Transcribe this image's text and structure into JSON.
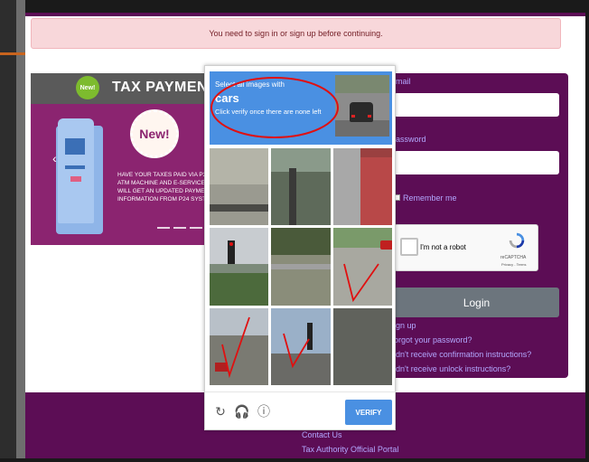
{
  "alert": {
    "message": "You need to sign in or sign up before continuing."
  },
  "banner": {
    "title": "TAX PAYMENT",
    "new_small": "New!",
    "new_big": "New!",
    "arrow": "‹",
    "text_lines": [
      "HAVE YOUR TAXES PAID VIA P2",
      "ATM MACHINE AND E-SERVICE",
      "WILL GET AN UPDATED PAYMEN",
      "INFORMATION FROM P24 SYSTE"
    ]
  },
  "login": {
    "email_label": "mail",
    "password_label": "assword",
    "remember_label": "Remember me",
    "login_button": "Login",
    "links": [
      "ign up",
      "orgot your password?",
      "idn't receive confirmation instructions?",
      "idn't receive unlock instructions?"
    ]
  },
  "recaptcha": {
    "checkbox_label": "I'm not a robot",
    "brand": "reCAPTCHA",
    "links": "Privacy - Terms"
  },
  "captcha": {
    "instruction": "Select all images with",
    "keyword": "cars",
    "instruction_sub": "Click verify once there are none left",
    "verify_button": "VERIFY",
    "reload_icon": "↻",
    "audio_icon": "🎧",
    "info_icon": "ⓘ",
    "tiles": [
      {
        "name": "tile-1",
        "bg": "#b4b4a8"
      },
      {
        "name": "tile-2",
        "bg": "#5e6a5a"
      },
      {
        "name": "tile-3",
        "bg": "#9a4040"
      },
      {
        "name": "tile-4",
        "bg": "#7c8a7a"
      },
      {
        "name": "tile-5",
        "bg": "#8a8d7a"
      },
      {
        "name": "tile-6",
        "bg": "#a8a8a0"
      },
      {
        "name": "tile-7",
        "bg": "#7a7a72"
      },
      {
        "name": "tile-8",
        "bg": "#9ab0c8"
      },
      {
        "name": "tile-9",
        "bg": "#6a6a62"
      }
    ]
  },
  "footer": {
    "links": [
      "Contact Us",
      "Tax Authority Official Portal"
    ]
  },
  "colors": {
    "brand_purple": "#5c0d55",
    "link_color": "#b3a8ff",
    "captcha_blue": "#4a90e2",
    "alert_bg": "#f8d7da",
    "annotation_red": "#e01010"
  }
}
